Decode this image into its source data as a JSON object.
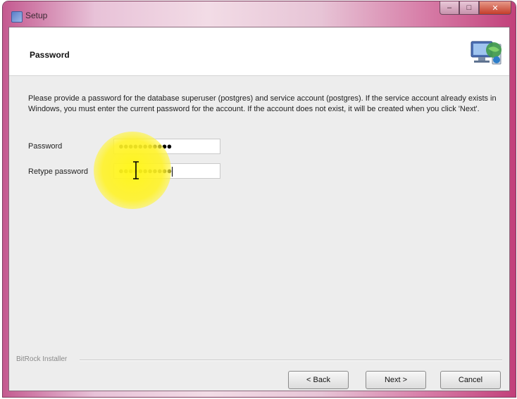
{
  "window": {
    "title": "Setup",
    "controls": {
      "minimize": "–",
      "maximize": "□",
      "close": "✕"
    }
  },
  "page": {
    "title": "Password",
    "description": "Please provide a password for the database superuser (postgres) and service account (postgres). If the service account already exists in Windows, you must enter the current password for the account. If the account does not exist, it will be created when you click 'Next'."
  },
  "form": {
    "password_label": "Password",
    "password_value": "●●●●●●●●●●●",
    "retype_label": "Retype password",
    "retype_value": "●●●●●●●●●●●"
  },
  "footer": {
    "installer_label": "BitRock Installer",
    "back_label": "< Back",
    "next_label": "Next >",
    "cancel_label": "Cancel"
  },
  "icons": {
    "app": "setup-app-icon",
    "header": "computer-globe-icon",
    "cursor": "text-ibeam-cursor-icon"
  },
  "colors": {
    "title_bar": "#d77ea8",
    "highlight": "#fff214",
    "dialog_bg": "#ededed"
  }
}
